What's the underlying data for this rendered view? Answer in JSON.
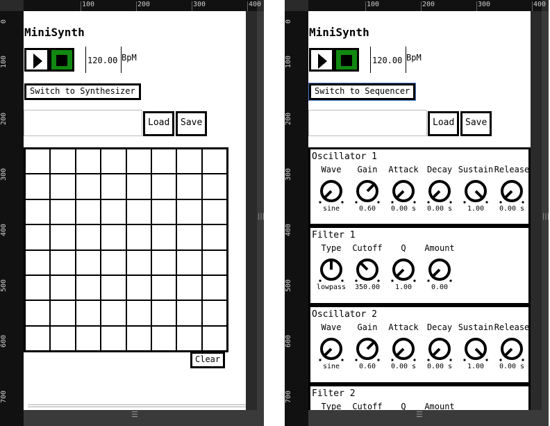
{
  "left": {
    "ruler_top": [
      "100",
      "200",
      "300",
      "400"
    ],
    "ruler_left": [
      "0",
      "100",
      "200",
      "300",
      "400",
      "500",
      "600",
      "700"
    ],
    "title": "MiniSynth",
    "tempo": "120.00",
    "tempo_unit": "BpM",
    "switch_label": "Switch to Synthesizer",
    "filename": "",
    "load_label": "Load",
    "save_label": "Save",
    "clear_label": "Clear",
    "grid": {
      "rows": 8,
      "cols": 8,
      "active_cells": 0
    }
  },
  "right": {
    "ruler_top": [
      "100",
      "200",
      "300",
      "400"
    ],
    "ruler_left": [
      "0",
      "100",
      "200",
      "300",
      "400",
      "500",
      "600",
      "700"
    ],
    "title": "MiniSynth",
    "tempo": "120.00",
    "tempo_unit": "BpM",
    "switch_label": "Switch to Sequencer",
    "filename": "",
    "load_label": "Load",
    "save_label": "Save",
    "osc1": {
      "title": "Oscillator 1",
      "labels": [
        "Wave",
        "Gain",
        "Attack",
        "Decay",
        "Sustain",
        "Release"
      ],
      "values": [
        "sine",
        "0.60",
        "0.00 s",
        "0.00 s",
        "1.00",
        "0.00 s"
      ]
    },
    "filter1": {
      "title": "Filter 1",
      "labels": [
        "Type",
        "Cutoff",
        "Q",
        "Amount"
      ],
      "values": [
        "lowpass",
        "350.00",
        "1.00",
        "0.00"
      ]
    },
    "osc2": {
      "title": "Oscillator 2",
      "labels": [
        "Wave",
        "Gain",
        "Attack",
        "Decay",
        "Sustain",
        "Release"
      ],
      "values": [
        "sine",
        "0.60",
        "0.00 s",
        "0.00 s",
        "1.00",
        "0.00 s"
      ]
    },
    "filter2": {
      "title": "Filter 2",
      "labels": [
        "Type",
        "Cutoff",
        "Q",
        "Amount"
      ]
    }
  },
  "colors": {
    "stop_active": "#118811",
    "ruler_bg": "#111111",
    "chrome": "#2a2a2a"
  }
}
